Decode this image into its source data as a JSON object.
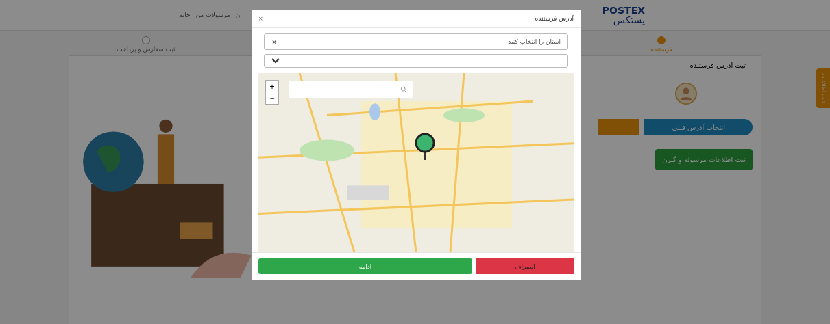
{
  "header": {
    "logo_latin": "POSTEX",
    "logo_persian": "پستکس",
    "nav": [
      {
        "label": "ن"
      },
      {
        "label": "مرسولات من"
      },
      {
        "label": "خانه"
      }
    ]
  },
  "steps": [
    {
      "label": "فرستنده",
      "selected": true
    },
    {
      "label": "ثبت سفارش و پرداخت",
      "selected": false
    }
  ],
  "card": {
    "title": "ثبت آدرس فرستنده",
    "previous_address_button": "انتخاب آدرس قبلی",
    "next_button": "ثبت اطلاعات مرسوله و گیرن"
  },
  "side_tab": "ثبت اطلاعات",
  "modal": {
    "title": "آدرس فرستنده",
    "close": "×",
    "province_select": {
      "placeholder": "استان را انتخاب کنید",
      "clear": "×"
    },
    "map": {
      "zoom_in": "+",
      "zoom_out": "−"
    },
    "buttons": [
      {
        "label": "انصراف",
        "kind": "danger"
      },
      {
        "label": "ادامه",
        "kind": "primary"
      }
    ]
  }
}
